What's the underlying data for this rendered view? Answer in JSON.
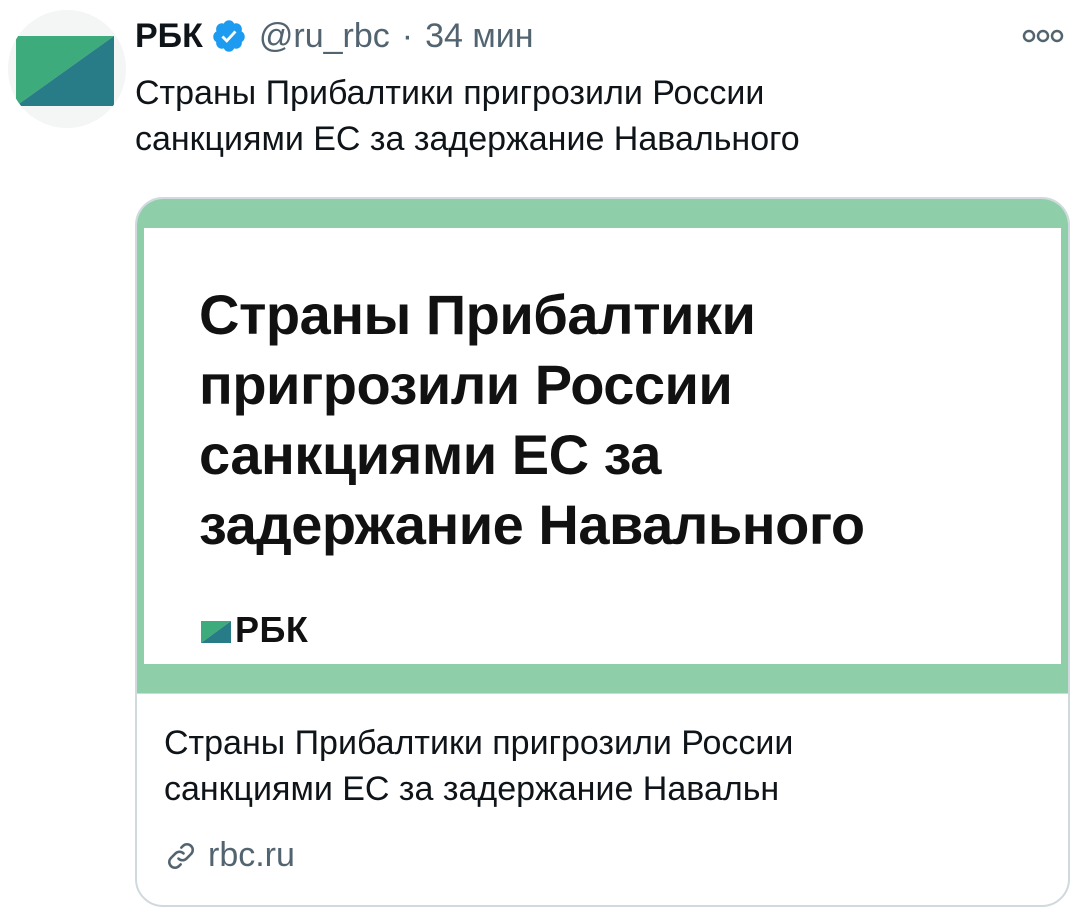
{
  "tweet": {
    "avatar_icon": "rbc-logo-icon",
    "display_name": "РБК",
    "verified_icon": "verified-badge-icon",
    "handle": "@ru_rbc",
    "separator": "·",
    "time": "34 мин",
    "more_icon": "more-dots-icon",
    "text_lines": [
      "Страны Прибалтики пригрозили России",
      "санкциями ЕС за задержание Навального"
    ]
  },
  "card": {
    "image": {
      "headline_lines": [
        "Страны Прибалтики",
        "пригрозили России",
        "санкциями ЕС за",
        "задержание Навального"
      ],
      "logo_icon": "rbc-logo-icon",
      "logo_text": "РБК"
    },
    "title_lines": [
      "Страны Прибалтики пригрозили России",
      "санкциями ЕС за задержание Навальн"
    ],
    "link_icon": "link-icon",
    "domain": "rbc.ru"
  },
  "colors": {
    "brand_green": "#2e9e74",
    "brand_teal": "#2a7f86",
    "card_frame": "#8ecfaa",
    "verified_blue": "#1d9bf0",
    "secondary_text": "#536471"
  }
}
